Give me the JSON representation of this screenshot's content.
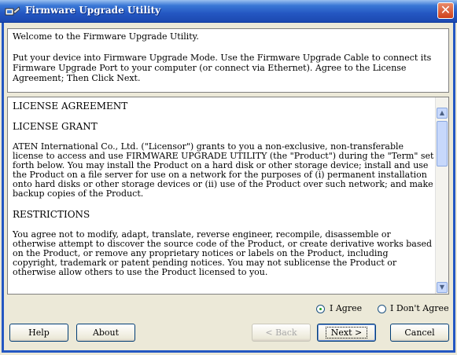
{
  "window": {
    "title": "Firmware Upgrade Utility",
    "close_glyph": "✕"
  },
  "welcome": {
    "line1": "Welcome to the Firmware Upgrade Utility.",
    "line2": "Put your device into Firmware Upgrade Mode. Use the Firmware Upgrade Cable to connect its Firmware Upgrade Port to your computer (or connect via Ethernet). Agree to the License Agreement; Then Click Next."
  },
  "license": {
    "title": "LICENSE AGREEMENT",
    "grant_heading": "LICENSE GRANT",
    "grant_text": "ATEN International Co., Ltd. (\"Licensor\") grants to you a non-exclusive, non-transferable license to access and use FIRMWARE UPGRADE UTILITY (the \"Product\") during the \"Term\" set forth below. You may install the Product on a hard disk or other storage device; install and use the Product on a file server for use on a network for the purposes of (i) permanent installation onto hard disks or other storage devices or (ii) use of the Product over such network; and make backup copies of the Product.",
    "restrictions_heading": "RESTRICTIONS",
    "restrictions_text": "You agree not to modify, adapt, translate, reverse engineer, recompile, disassemble or otherwise attempt to discover the source code of the Product, or create derivative works based on the Product, or remove any proprietary notices or labels on the Product, including copyright, trademark or patent pending notices. You may not sublicense the Product or otherwise allow others to use the Product licensed to you.",
    "scroll_up_glyph": "▲",
    "scroll_down_glyph": "▼"
  },
  "agreement": {
    "agree_label": "I Agree",
    "disagree_label": "I Don't Agree",
    "selected": "agree"
  },
  "buttons": {
    "help": "Help",
    "about": "About",
    "back": "< Back",
    "next": "Next >",
    "cancel": "Cancel"
  },
  "colors": {
    "title_bar": "#2457c2",
    "dialog_bg": "#ece9d8",
    "close_button": "#d0401a"
  },
  "icons": {
    "title": "utility-app-icon",
    "close": "close-icon"
  }
}
